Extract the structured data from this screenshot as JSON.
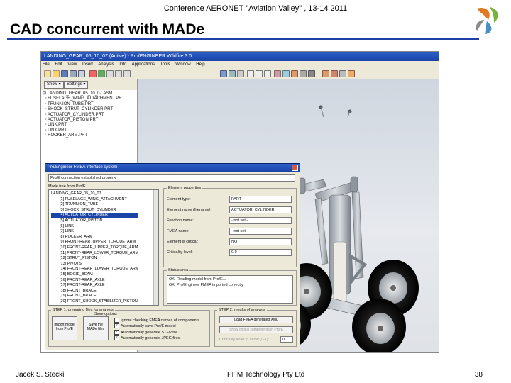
{
  "slide": {
    "header": "Conference AERONET \"Aviation Valley\" , 13-14 2011",
    "title": "CAD concurrent with MADe",
    "footer_left": "Jacek S. Stecki",
    "footer_center": "PHM Technology Pty Ltd",
    "page_number": "38"
  },
  "app": {
    "window_title": "LANDING_GEAR_05_10_07 (Active) - Pro/ENGINEER Wildfire 3.0",
    "menu": [
      "File",
      "Edit",
      "View",
      "Insert",
      "Analysis",
      "Info",
      "Applications",
      "Tools",
      "Window",
      "Help"
    ],
    "show_button": "Show ▾",
    "settings_button": "Settings ▾",
    "tree_items": [
      "LANDING_GEAR_05_10_07.ASM",
      "FUSELAGE_WING_ATTACHMENT.PRT",
      "TRUNNION_TUBE.PRT",
      "SHOCK_STRUT_CYLINDER.PRT",
      "ACTUATOR_CYLINDER.PRT",
      "ACTUATOR_PISTON.PRT",
      "LINK.PRT",
      "LINK.PRT",
      "ROCKER_ARM.PRT"
    ]
  },
  "dialog": {
    "title": "Pro/Engineer FMEA interface system",
    "status_label": "Pro/E connection established properly",
    "mode_tree_label": "Mode tree from Pro/E",
    "tree_items": [
      "LANDING_GEAR_05_10_07",
      "[1] FUSELAGE_WING_ATTACHMENT",
      "[2] TRUNNION_TUBE",
      "[3] SHOCK_STRUT_CYLINDER",
      "[4] ACTUATOR_CYLINDER",
      "[5] ACTUATOR_PISTON",
      "[6] LINK",
      "[7] LINK",
      "[8] ROCKER_ARM",
      "[9] FRONT-REAR_UPPER_TORQUE_ARM",
      "[10] FRONT-REAR_UPPER_TORQUE_ARM",
      "[11] FRONT-REAR_LOWER_TORQUE_ARM",
      "[12] STRUT_PISTON",
      "[13] PIVOTS",
      "[14] FRONT-REAR_LOWER_TORQUE_ARM",
      "[15] BOGIE_BEAM",
      "[16] FRONT-REAR_AXLE",
      "[17] FRONT-REAR_AXLE",
      "[18] FRONT_BRACE",
      "[19] FRONT_BRACE",
      "[20] FRONT_SHOCK_STABILIZER_PISTON"
    ],
    "selected_index": 4,
    "element_properties_label": "Element properties",
    "properties": [
      {
        "label": "Element type:",
        "value": "PART"
      },
      {
        "label": "Element name (filename):",
        "value": "ACTUATOR_CYLINDER"
      },
      {
        "label": "Function name:",
        "value": "- not set -"
      },
      {
        "label": "FMEA name:",
        "value": "- not set -"
      },
      {
        "label": "Element is critical:",
        "value": "NO"
      },
      {
        "label": "Criticality level:",
        "value": "0.0"
      }
    ],
    "status_area_label": "Status area",
    "status_lines": [
      "OK:   Reading model from Pro/E...",
      "OK:   Pro/Engineer FMEA imported correctly"
    ],
    "step1_label": "STEP 1: preparing files for analysis",
    "save_options_label": "Save options",
    "import_button": "Import model from Pro/E",
    "save_button": "Save the MADe files",
    "options": [
      "Ignore checking FMEA names of components",
      "Automatically save Pro/E model",
      "Automatically generate STEP file",
      "Automatically generate JPEG files"
    ],
    "step2_label": "STEP 2: results of analysis",
    "load_button": "Load FMEA generated XML",
    "show_button": "Show critical components in Pro/E",
    "criticality_label": "Criticality level to show (0-1):",
    "criticality_value": "0"
  },
  "colors": {
    "title_rule": "#1f3fa8",
    "titlebar": "#2c5fc7",
    "selection": "#1a44a8"
  }
}
